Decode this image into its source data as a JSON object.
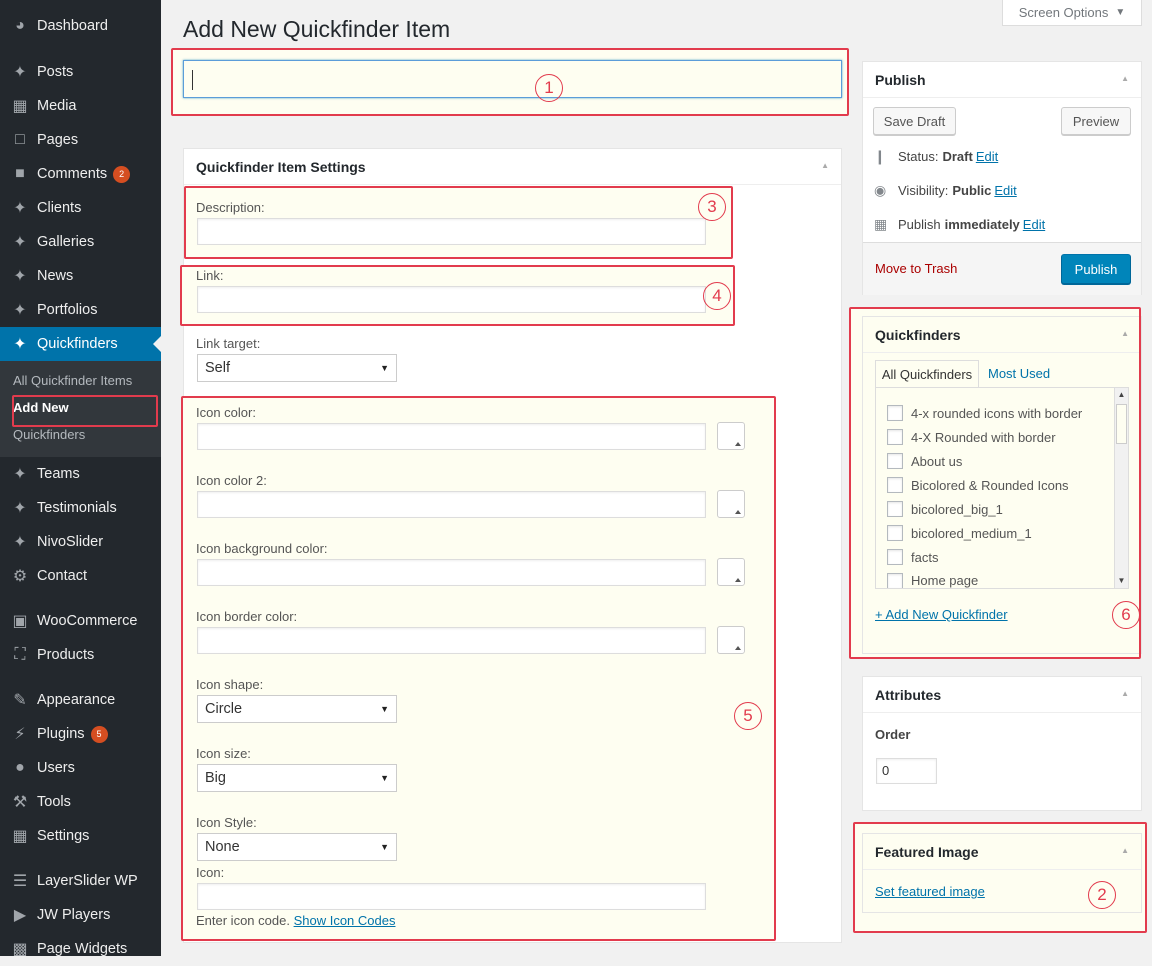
{
  "screen_options": {
    "label": "Screen Options",
    "icon": "caret-down-icon"
  },
  "page": {
    "title": "Add New Quickfinder Item",
    "title_input_value": ""
  },
  "sidebar": {
    "items": [
      {
        "label": "Dashboard",
        "icon": "dashboard-icon"
      },
      {
        "label": "Posts",
        "icon": "pin-icon"
      },
      {
        "label": "Media",
        "icon": "media-icon"
      },
      {
        "label": "Pages",
        "icon": "pages-icon"
      },
      {
        "label": "Comments",
        "icon": "comment-icon",
        "badge": "2"
      },
      {
        "label": "Clients",
        "icon": "pin-icon"
      },
      {
        "label": "Galleries",
        "icon": "pin-icon"
      },
      {
        "label": "News",
        "icon": "pin-icon"
      },
      {
        "label": "Portfolios",
        "icon": "pin-icon"
      },
      {
        "label": "Quickfinders",
        "icon": "pin-icon",
        "active": true
      },
      {
        "label": "Teams",
        "icon": "pin-icon"
      },
      {
        "label": "Testimonials",
        "icon": "pin-icon"
      },
      {
        "label": "NivoSlider",
        "icon": "pin-icon"
      },
      {
        "label": "Contact",
        "icon": "gear-icon"
      },
      {
        "label": "WooCommerce",
        "icon": "woocommerce-icon"
      },
      {
        "label": "Products",
        "icon": "cart-icon"
      },
      {
        "label": "Appearance",
        "icon": "brush-icon"
      },
      {
        "label": "Plugins",
        "icon": "plugin-icon",
        "badge": "5"
      },
      {
        "label": "Users",
        "icon": "user-icon"
      },
      {
        "label": "Tools",
        "icon": "wrench-icon"
      },
      {
        "label": "Settings",
        "icon": "settings-icon"
      },
      {
        "label": "LayerSlider WP",
        "icon": "layers-icon"
      },
      {
        "label": "JW Players",
        "icon": "jw-icon"
      },
      {
        "label": "Page Widgets",
        "icon": "widgets-icon"
      }
    ],
    "submenu": [
      {
        "label": "All Quickfinder Items"
      },
      {
        "label": "Add New",
        "current": true
      },
      {
        "label": "Quickfinders"
      }
    ]
  },
  "settings_box": {
    "title": "Quickfinder Item Settings",
    "description_label": "Description:",
    "link_label": "Link:",
    "link_target_label": "Link target:",
    "link_target_value": "Self",
    "icon_color_label": "Icon color:",
    "icon_color2_label": "Icon color 2:",
    "icon_bg_color_label": "Icon background color:",
    "icon_border_color_label": "Icon border color:",
    "icon_shape_label": "Icon shape:",
    "icon_shape_value": "Circle",
    "icon_size_label": "Icon size:",
    "icon_size_value": "Big",
    "icon_style_label": "Icon Style:",
    "icon_style_value": "None",
    "icon_label": "Icon:",
    "icon_help": "Enter icon code.",
    "icon_help_link": "Show Icon Codes"
  },
  "publish_box": {
    "title": "Publish",
    "save_draft": "Save Draft",
    "preview": "Preview",
    "status_label": "Status:",
    "status_value": "Draft",
    "visibility_label": "Visibility:",
    "visibility_value": "Public",
    "publish_label": "Publish",
    "publish_value": "immediately",
    "edit": "Edit",
    "move_to_trash": "Move to Trash",
    "publish_button": "Publish"
  },
  "quickfinders_box": {
    "title": "Quickfinders",
    "tab_all": "All Quickfinders",
    "tab_most_used": "Most Used",
    "items": [
      "4-x rounded icons with border",
      "4-X Rounded with border",
      "About us",
      "Bicolored & Rounded Icons",
      "bicolored_big_1",
      "bicolored_medium_1",
      "facts",
      "Home page"
    ],
    "add_new": "+ Add New Quickfinder"
  },
  "attributes_box": {
    "title": "Attributes",
    "order_label": "Order",
    "order_value": "0"
  },
  "featured_image_box": {
    "title": "Featured Image",
    "set_link": "Set featured image"
  },
  "annotations": [
    "1",
    "2",
    "3",
    "4",
    "5",
    "6"
  ],
  "colors": {
    "annotation_red": "#e23b4d",
    "highlight_yellow": "#fefef1",
    "sidebar_bg": "#23282d",
    "accent_blue": "#0073aa"
  }
}
